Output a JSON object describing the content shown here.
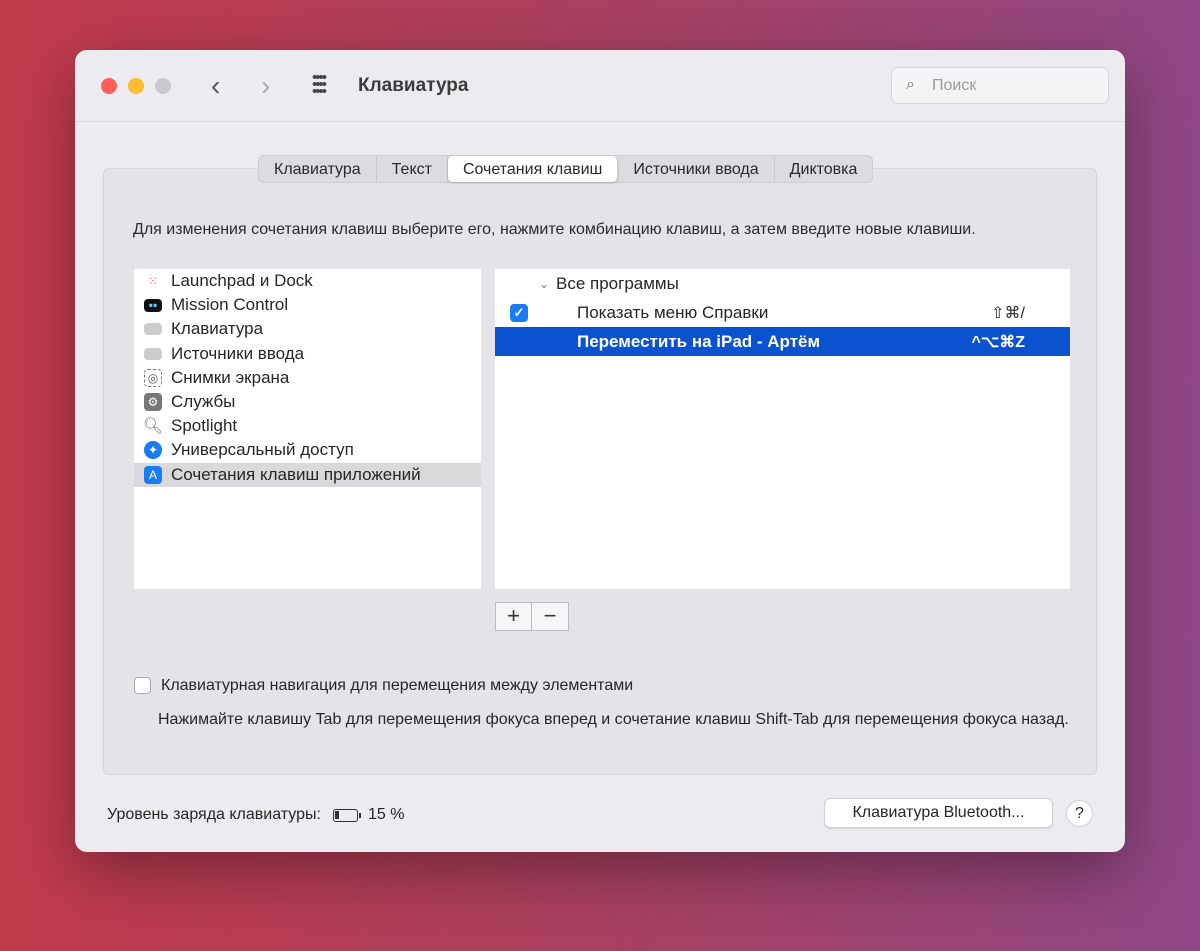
{
  "window": {
    "title": "Клавиатура",
    "search_placeholder": "Поиск"
  },
  "tabs": [
    "Клавиатура",
    "Текст",
    "Сочетания клавиш",
    "Источники ввода",
    "Диктовка"
  ],
  "description": "Для изменения сочетания клавиш выберите его, нажмите комбинацию клавиш, а затем введите новые клавиши.",
  "categories": [
    {
      "label": "Launchpad и Dock",
      "icon": "launchpad-icon"
    },
    {
      "label": "Mission Control",
      "icon": "mission-control-icon"
    },
    {
      "label": "Клавиатура",
      "icon": "keyboard-icon"
    },
    {
      "label": "Источники ввода",
      "icon": "keyboard-icon"
    },
    {
      "label": "Снимки экрана",
      "icon": "screenshot-icon"
    },
    {
      "label": "Службы",
      "icon": "gear-icon"
    },
    {
      "label": "Spotlight",
      "icon": "magnifier-icon"
    },
    {
      "label": "Универсальный доступ",
      "icon": "accessibility-icon"
    },
    {
      "label": "Сочетания клавиш приложений",
      "icon": "app-store-icon"
    }
  ],
  "shortcuts": {
    "group": "Все программы",
    "items": [
      {
        "label": "Показать меню Справки",
        "keys": "⇧⌘/",
        "checked": true
      },
      {
        "label": "Переместить на iPad - Артём",
        "keys": "^⌥⌘Z"
      }
    ]
  },
  "buttons": {
    "add": "+",
    "remove": "−",
    "bluetooth": "Клавиатура Bluetooth...",
    "help": "?"
  },
  "keyboard_nav": {
    "label": "Клавиатурная навигация для перемещения между элементами",
    "checked": false,
    "hint": "Нажимайте клавишу Tab для перемещения фокуса вперед и сочетание клавиш Shift-Tab для перемещения фокуса назад."
  },
  "battery": {
    "label": "Уровень заряда клавиатуры:",
    "value": "15 %"
  }
}
